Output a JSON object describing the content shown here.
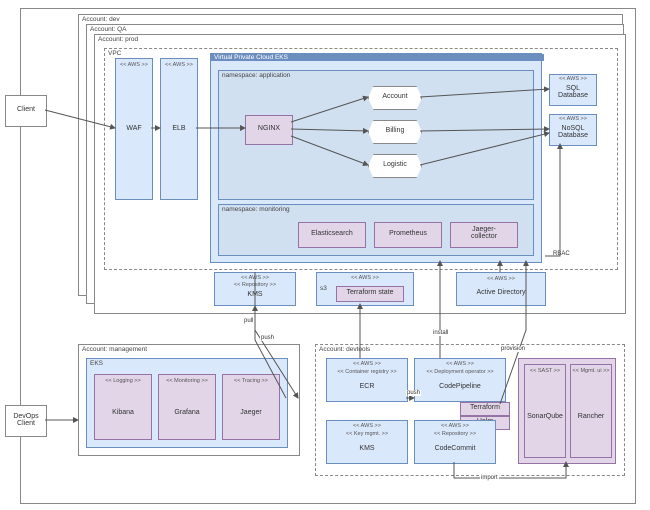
{
  "accounts": {
    "dev": "Account: dev",
    "qa": "Account: QA",
    "prod": "Account: prod",
    "mgmt": "Account: management",
    "devtools": "Account: devtools"
  },
  "vpc": "VPC",
  "eks": "Virtual Private Cloud EKS",
  "ns_app": "namespace: application",
  "ns_mon": "namespace: monitoring",
  "aws_stereo": "<< AWS >>",
  "repo_stereo": "<< Repository >>",
  "logging_stereo": "<< Logging >>",
  "monitoring_stereo": "<< Monitoring >>",
  "tracing_stereo": "<< Tracing >>",
  "container_registry_stereo": "<< Container registry >>",
  "deploy_op_stereo": "<< Deployment operator >>",
  "key_mgmt_stereo": "<< Key mgmt. >>",
  "sast_stereo": "<< SAST >>",
  "mgmt_ui_stereo": "<< Mgmt. ui >>",
  "nodes": {
    "client": "Client",
    "devops": "DevOps\nClient",
    "waf": "WAF",
    "elb": "ELB",
    "nginx": "NGINX",
    "account": "Account",
    "billing": "Billing",
    "logistic": "Logistic",
    "sql": "SQL\nDatabase",
    "nosql": "NoSQL\nDatabase",
    "elastic": "Elasticsearch",
    "prometheus": "Prometheus",
    "jaeger_col": "Jaeger-\ncollector",
    "kms_repo": "KMS",
    "s3": "s3",
    "tfstate": "Terraform state",
    "ad": "Active Directory",
    "rbac": "RBAC",
    "eks_mgmt": "EKS",
    "kibana": "Kibana",
    "grafana": "Grafana",
    "jaeger": "Jaeger",
    "ecr": "ECR",
    "codepipeline": "CodePipeline",
    "terraform": "Terraform",
    "helm": "Helm",
    "kms2": "KMS",
    "codecommit": "CodeCommit",
    "sonarqube": "SonarQube",
    "rancher": "Rancher"
  },
  "edges": {
    "pull": "pull",
    "push": "push",
    "push2": "push",
    "install": "install",
    "provision": "provision",
    "import": "import"
  }
}
